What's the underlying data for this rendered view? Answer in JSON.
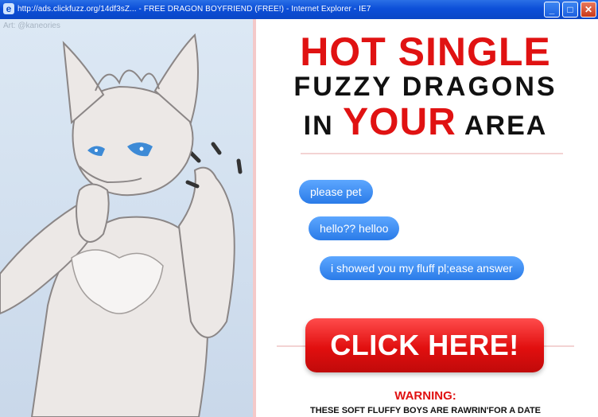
{
  "window": {
    "title": "http://ads.clickfuzz.org/14df3sZ... - FREE DRAGON BOYFRIEND (FREE!) - Internet Explorer - IE7",
    "minimize_label": "_",
    "maximize_label": "□",
    "close_label": "✕"
  },
  "art": {
    "credit": "Art: @kaneories"
  },
  "ad": {
    "headline_line1": "HOT SINGLE",
    "headline_line2": "FUZZY DRAGONS",
    "headline_line3_prefix": "IN",
    "headline_line3_emph": "YOUR",
    "headline_line3_suffix": "AREA",
    "messages": [
      "please pet",
      "hello?? helloo",
      "i showed you my fluff pl;ease answer"
    ],
    "cta_label": "CLICK HERE!",
    "warning_title": "WARNING:",
    "warning_text": "THESE SOFT FLUFFY BOYS ARE RAWRIN'FOR A DATE"
  },
  "colors": {
    "accent_red": "#e01212",
    "bubble_blue": "#2a7be8",
    "titlebar_blue": "#0c4fd8"
  }
}
